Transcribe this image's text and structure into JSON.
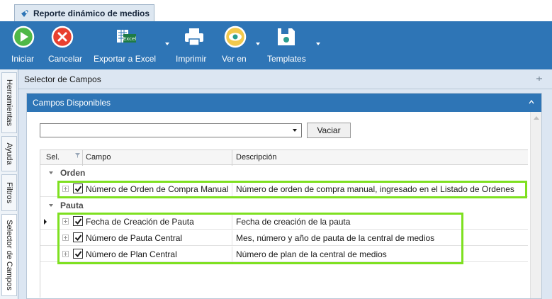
{
  "window": {
    "tab_title": "Reporte dinámico de medios"
  },
  "toolbar": {
    "buttons": [
      {
        "label": "Iniciar",
        "icon": "play-icon"
      },
      {
        "label": "Cancelar",
        "icon": "cancel-icon"
      },
      {
        "label": "Exportar a Excel",
        "icon": "excel-icon",
        "icon_text": "Excel"
      },
      {
        "label": "Imprimir",
        "icon": "printer-icon"
      },
      {
        "label": "Ver en",
        "icon": "eye-icon"
      },
      {
        "label": "Templates",
        "icon": "save-disk-icon"
      }
    ]
  },
  "side_tabs": [
    "Herramientas",
    "Ayuda",
    "Filtros",
    "Selector de Campos"
  ],
  "selector": {
    "title": "Selector de Campos"
  },
  "panel": {
    "title": "Campos Disponibles",
    "combo_value": "",
    "clear_button": "Vaciar"
  },
  "grid": {
    "columns": [
      "Sel.",
      "Campo",
      "Descripción"
    ],
    "groups": [
      {
        "name": "Orden",
        "rows": [
          {
            "checked": true,
            "campo": "Número de Orden de Compra Manual",
            "descripcion": "Número de orden de compra manual, ingresado en el Listado de Ordenes"
          }
        ]
      },
      {
        "name": "Pauta",
        "rows": [
          {
            "checked": true,
            "campo": "Fecha de Creación de Pauta",
            "descripcion": "Fecha de creación de la pauta",
            "current": true
          },
          {
            "checked": true,
            "campo": "Número de Pauta Central",
            "descripcion": "Mes, número y año de pauta de la central de medios"
          },
          {
            "checked": true,
            "campo": "Número de Plan Central",
            "descripcion": "Número de plan de la central de medios"
          }
        ]
      }
    ]
  },
  "colors": {
    "ribbon": "#2e75b6",
    "highlight": "#7ee020",
    "panel_bg": "#dce6f2"
  }
}
